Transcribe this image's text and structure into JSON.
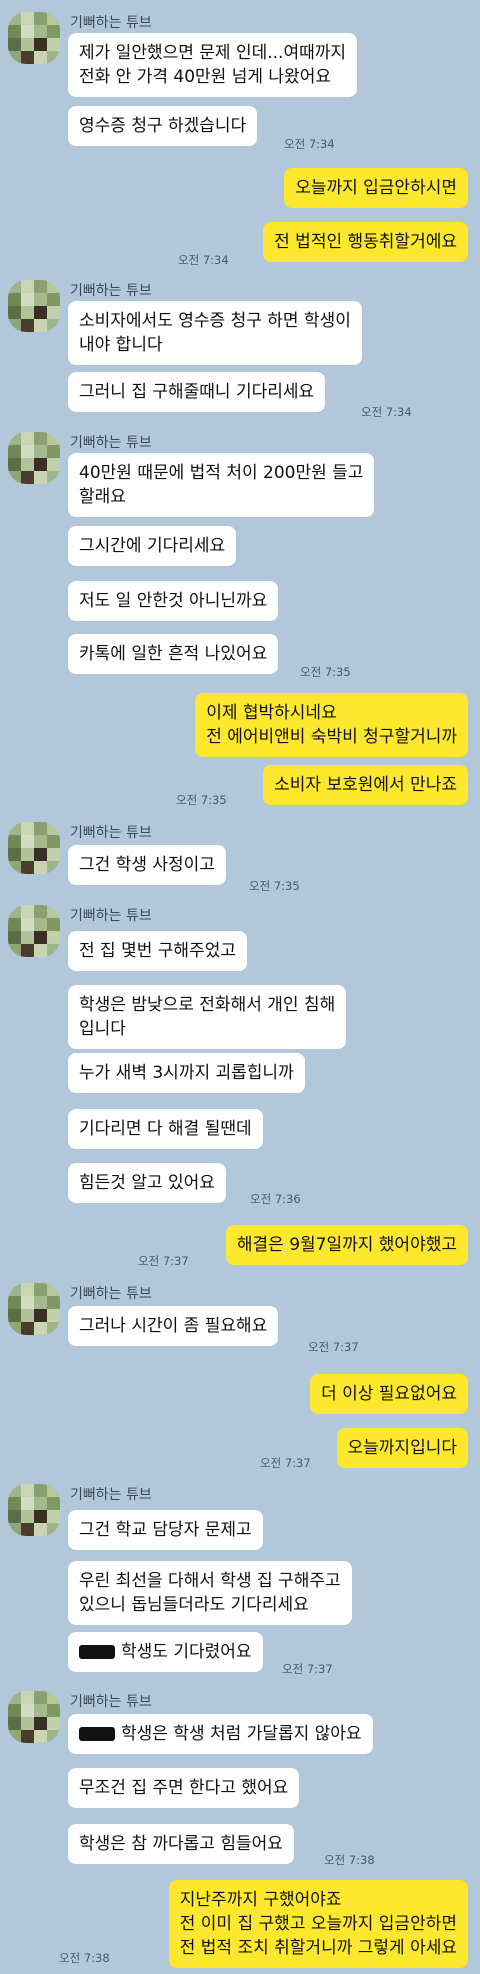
{
  "chat": {
    "sender_name": "기뻐하는 튜브",
    "msgs": {
      "m1": "제가 일안했으면 문제 인데...여때까지\n전화 안 가격 40만원 넘게 나왔어요",
      "m2": "영수증 청구 하겠습니다",
      "m3": "오늘까지 입금안하시면",
      "m4": "전 법적인 행동취할거에요",
      "m5": "소비자에서도 영수증 청구 하면 학생이\n내야 합니다",
      "m6": "그러니 집 구해줄때니 기다리세요",
      "m7": "40만원 때문에 법적 처이 200만원 들고\n할래요",
      "m8": "그시간에 기다리세요",
      "m9": "저도 일 안한것 아니닌까요",
      "m10": "카톡에 일한 흔적 나있어요",
      "m11": "이제 협박하시네요\n전 에어비앤비 숙박비 청구할거니까",
      "m12": "소비자 보호원에서 만나죠",
      "m13": "그건 학생 사정이고",
      "m14": "전 집 몇번 구해주었고",
      "m15": "학생은 밤낮으로 전화해서 개인 침해\n입니다",
      "m16": "누가 새벽 3시까지 괴롭힙니까",
      "m17": "기다리면 다 해결 될땐데",
      "m18": "힘든것 알고 있어요",
      "m19": "해결은 9월7일까지 했어야했고",
      "m20": "그러나 시간이 좀 필요해요",
      "m21": "더 이상 필요없어요",
      "m22": "오늘까지입니다",
      "m23": "그건 학교 담당자 문제고",
      "m24": "우린 최선을 다해서 학생 집 구해주고\n있으니 돕님들더라도 기다리세요",
      "m25": "학생도 기다렸어요",
      "m26": "학생은 학생 처럼 가달롭지 않아요",
      "m27": "무조건 집 주면 한다고 했어요",
      "m28": "학생은 참 까다롭고 힘들어요",
      "m29": "지난주까지 구했어야죠\n전 이미 집 구했고 오늘까지 입금안하면\n전 법적 조치 취할거니까 그렇게 아세요"
    },
    "times": {
      "t1": "오전 7:34",
      "t2": "오전 7:34",
      "t3": "오전 7:34",
      "t4": "오전 7:35",
      "t5": "오전 7:35",
      "t6": "오전 7:35",
      "t7": "오전 7:36",
      "t8": "오전 7:37",
      "t9": "오전 7:37",
      "t10": "오전 7:37",
      "t11": "오전 7:37",
      "t12": "오전 7:38",
      "t13": "오전 7:38"
    }
  },
  "colors": {
    "background": "#b2c7d9",
    "my_bubble": "#fde82d",
    "their_bubble": "#ffffff"
  }
}
